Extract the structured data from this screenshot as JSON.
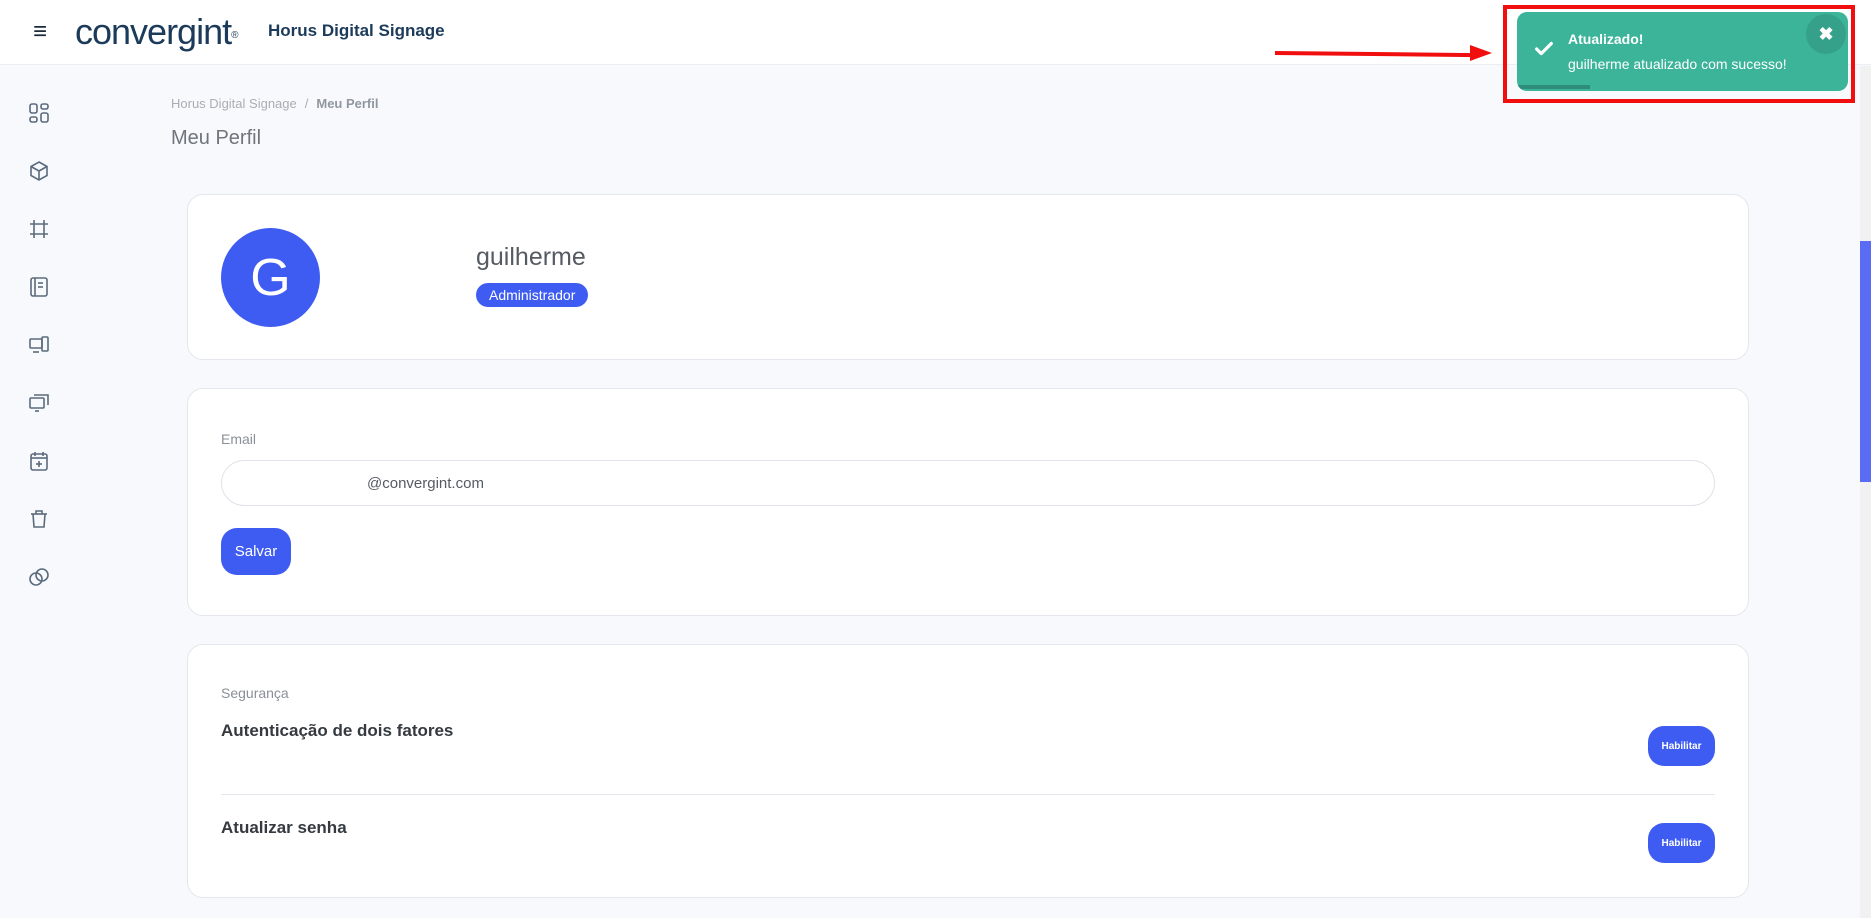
{
  "header": {
    "menu_icon": "hamburger-icon",
    "logo_text": "convergint",
    "logo_mark": "®",
    "app_title": "Horus Digital Signage",
    "icons": [
      "search-icon",
      "moon-icon",
      "apps-grid-icon"
    ]
  },
  "sidebar": {
    "items": [
      {
        "icon": "dashboard-icon"
      },
      {
        "icon": "cube-icon"
      },
      {
        "icon": "frame-icon"
      },
      {
        "icon": "notebook-icon"
      },
      {
        "icon": "devices-icon"
      },
      {
        "icon": "monitors-icon"
      },
      {
        "icon": "calendar-plus-icon"
      },
      {
        "icon": "trash-icon"
      },
      {
        "icon": "copy-icon"
      }
    ]
  },
  "breadcrumb": {
    "root": "Horus Digital Signage",
    "separator": "/",
    "current": "Meu Perfil"
  },
  "page_title": "Meu Perfil",
  "profile": {
    "avatar_initial": "G",
    "name": "guilherme",
    "role": "Administrador"
  },
  "email_form": {
    "label": "Email",
    "value": "@convergint.com",
    "save_label": "Salvar"
  },
  "security": {
    "label": "Segurança",
    "rows": [
      {
        "title": "Autenticação de dois fatores",
        "button": "Habilitar"
      },
      {
        "title": "Atualizar senha",
        "button": "Habilitar"
      }
    ]
  },
  "toast": {
    "title": "Atualizado!",
    "message": "guilherme atualizado com sucesso!",
    "close": "✖",
    "progress": 0.22
  },
  "colors": {
    "primary": "#3e5cf2",
    "toast_bg": "#3cb49a",
    "annotation": "#f10e0e",
    "brand": "#1c3b5a"
  }
}
